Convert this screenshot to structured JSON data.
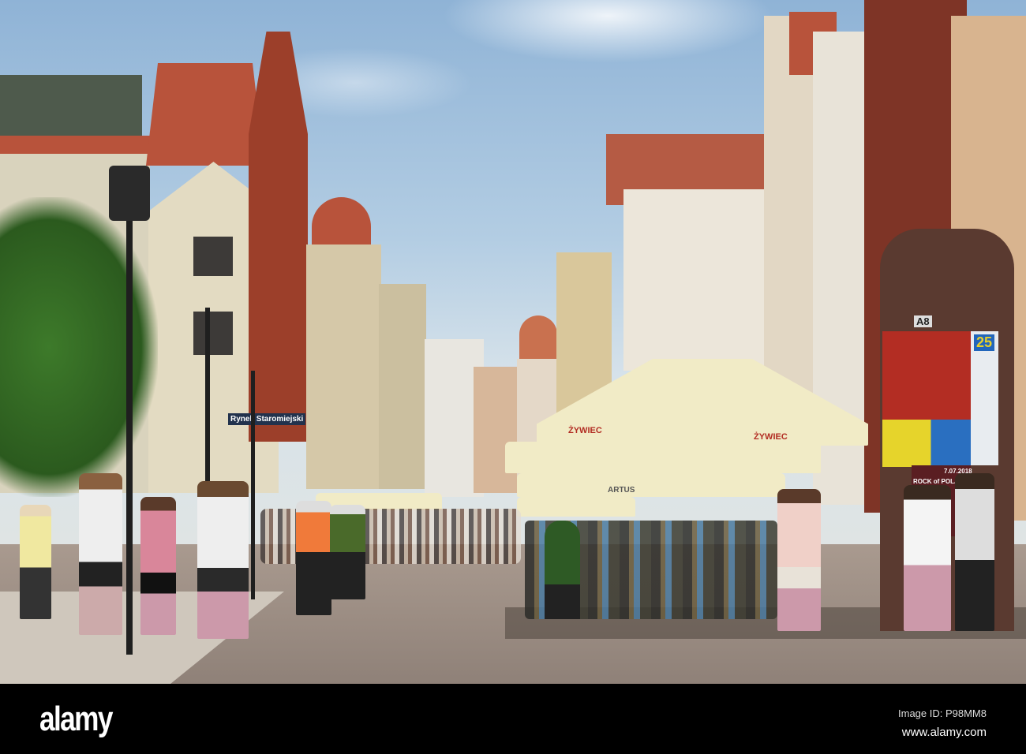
{
  "scene": {
    "street_sign": "Rynek Staromiejski",
    "umbrella_brand": "ŻYWIEC",
    "umbrella_brand_2": "ŻYWIEC",
    "restaurant_sign": "ARTUS",
    "kiosk_number": "A8",
    "poster_date": "7.07.2018",
    "poster_title": "ROCK of POLAND",
    "poster_number": "25"
  },
  "footer": {
    "logo": "alamy",
    "image_id": "Image ID: P98MM8",
    "url": "www.alamy.com"
  },
  "colors": {
    "sky": "#a9c4de",
    "roof": "#b8533b",
    "umbrella": "#f1ebc6",
    "footer": "#000000"
  }
}
